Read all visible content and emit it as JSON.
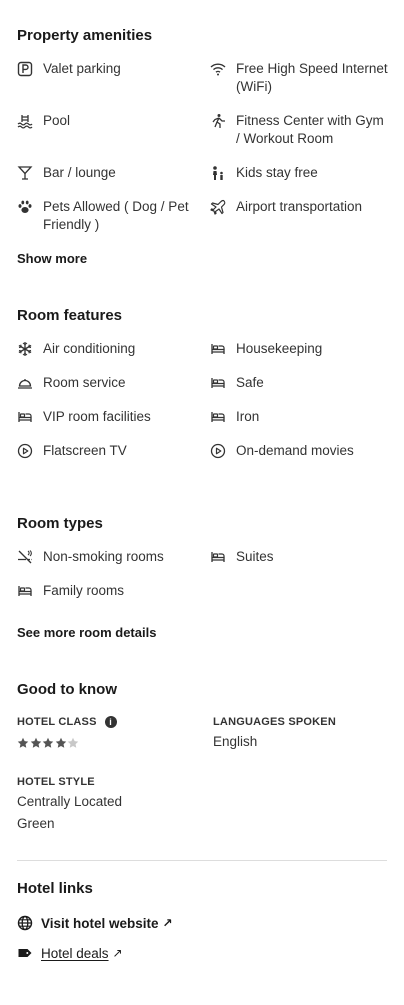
{
  "amenities": {
    "title": "Property amenities",
    "items": [
      {
        "label": "Valet parking",
        "icon": "parking-icon"
      },
      {
        "label": "Free High Speed Internet (WiFi)",
        "icon": "wifi-icon"
      },
      {
        "label": "Pool",
        "icon": "pool-icon"
      },
      {
        "label": "Fitness Center with Gym / Workout Room",
        "icon": "fitness-icon"
      },
      {
        "label": "Bar / lounge",
        "icon": "cocktail-icon"
      },
      {
        "label": "Kids stay free",
        "icon": "kids-icon"
      },
      {
        "label": "Pets Allowed ( Dog / Pet Friendly )",
        "icon": "paw-icon"
      },
      {
        "label": "Airport transportation",
        "icon": "plane-icon"
      }
    ],
    "show_more": "Show more"
  },
  "room_features": {
    "title": "Room features",
    "items": [
      {
        "label": "Air conditioning",
        "icon": "snowflake-icon"
      },
      {
        "label": "Housekeeping",
        "icon": "bed-icon"
      },
      {
        "label": "Room service",
        "icon": "cloche-icon"
      },
      {
        "label": "Safe",
        "icon": "bed-icon"
      },
      {
        "label": "VIP room facilities",
        "icon": "bed-icon"
      },
      {
        "label": "Iron",
        "icon": "bed-icon"
      },
      {
        "label": "Flatscreen TV",
        "icon": "play-icon"
      },
      {
        "label": "On-demand movies",
        "icon": "play-icon"
      }
    ]
  },
  "room_types": {
    "title": "Room types",
    "items": [
      {
        "label": "Non-smoking rooms",
        "icon": "no-smoking-icon"
      },
      {
        "label": "Suites",
        "icon": "bed-icon"
      },
      {
        "label": "Family rooms",
        "icon": "bed-icon"
      }
    ],
    "see_more": "See more room details"
  },
  "good_to_know": {
    "title": "Good to know",
    "hotel_class_label": "HOTEL CLASS",
    "hotel_class_rating": 4,
    "hotel_class_max": 5,
    "languages_label": "LANGUAGES SPOKEN",
    "languages_value": "English",
    "hotel_style_label": "HOTEL STYLE",
    "hotel_styles": [
      "Centrally Located",
      "Green"
    ]
  },
  "hotel_links": {
    "title": "Hotel links",
    "visit_website": "Visit hotel website",
    "hotel_deals": "Hotel deals",
    "external_arrow": "↗"
  },
  "colors": {
    "text": "#333333",
    "heading": "#1a1a1a",
    "star_filled": "#555555",
    "star_empty": "#c8c8c8",
    "divider": "#dddddd"
  }
}
